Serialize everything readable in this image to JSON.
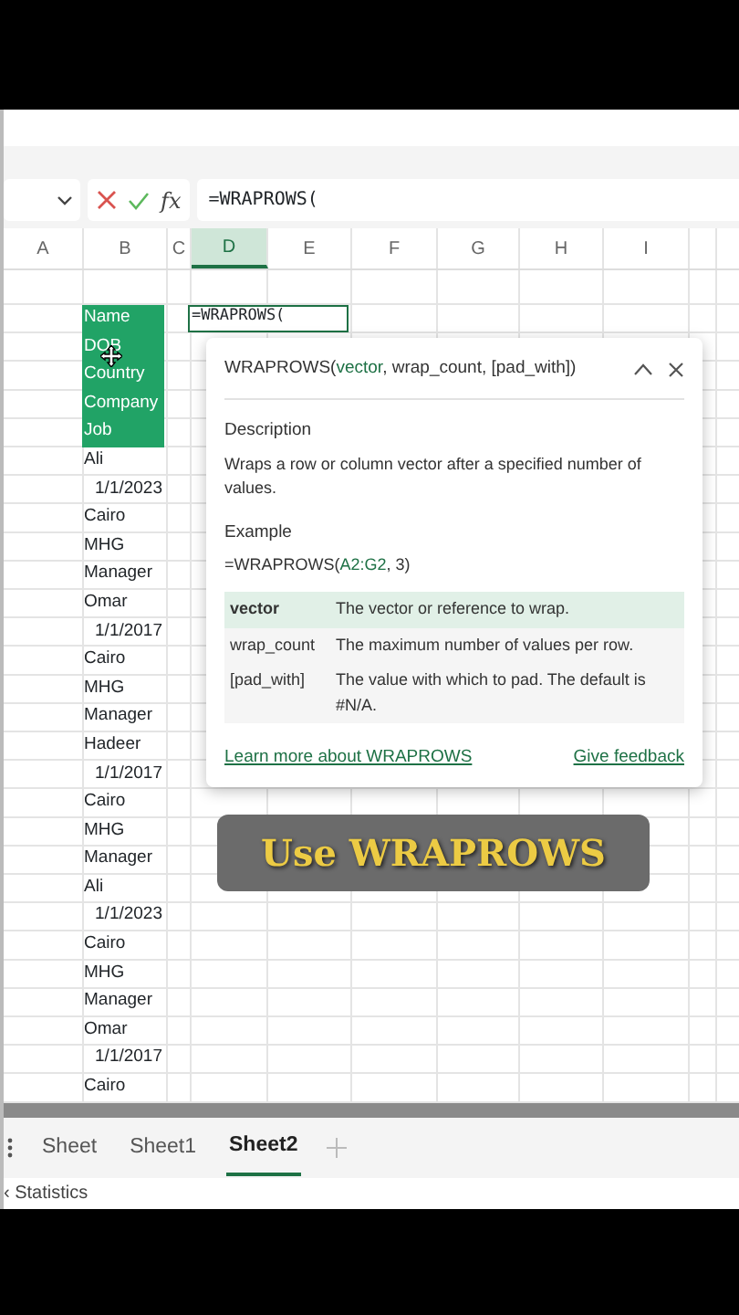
{
  "formula_bar": {
    "fx_label": "fx",
    "formula": "=WRAPROWS("
  },
  "columns": [
    {
      "label": "A",
      "selected": false
    },
    {
      "label": "B",
      "selected": false
    },
    {
      "label": "C",
      "selected": false
    },
    {
      "label": "D",
      "selected": true
    },
    {
      "label": "E",
      "selected": false
    },
    {
      "label": "F",
      "selected": false
    },
    {
      "label": "G",
      "selected": false
    },
    {
      "label": "H",
      "selected": false
    },
    {
      "label": "I",
      "selected": false
    }
  ],
  "column_b": [
    {
      "text": "Name",
      "kind": "header"
    },
    {
      "text": "DOB",
      "kind": "header"
    },
    {
      "text": "Country",
      "kind": "header"
    },
    {
      "text": "Company",
      "kind": "header"
    },
    {
      "text": "Job",
      "kind": "header"
    },
    {
      "text": "Ali",
      "kind": "text"
    },
    {
      "text": "1/1/2023",
      "kind": "date"
    },
    {
      "text": "Cairo",
      "kind": "text"
    },
    {
      "text": "MHG",
      "kind": "text"
    },
    {
      "text": "Manager",
      "kind": "text"
    },
    {
      "text": "Omar",
      "kind": "text"
    },
    {
      "text": "1/1/2017",
      "kind": "date"
    },
    {
      "text": "Cairo",
      "kind": "text"
    },
    {
      "text": "MHG",
      "kind": "text"
    },
    {
      "text": "Manager",
      "kind": "text"
    },
    {
      "text": "Hadeer",
      "kind": "text"
    },
    {
      "text": "1/1/2017",
      "kind": "date"
    },
    {
      "text": "Cairo",
      "kind": "text"
    },
    {
      "text": "MHG",
      "kind": "text"
    },
    {
      "text": "Manager",
      "kind": "text"
    },
    {
      "text": "Ali",
      "kind": "text"
    },
    {
      "text": "1/1/2023",
      "kind": "date"
    },
    {
      "text": "Cairo",
      "kind": "text"
    },
    {
      "text": "MHG",
      "kind": "text"
    },
    {
      "text": "Manager",
      "kind": "text"
    },
    {
      "text": "Omar",
      "kind": "text"
    },
    {
      "text": "1/1/2017",
      "kind": "date"
    },
    {
      "text": "Cairo",
      "kind": "text"
    }
  ],
  "active_cell": {
    "text": "=WRAPROWS("
  },
  "tooltip": {
    "signature": [
      {
        "text": "WRAPROWS(",
        "current": false
      },
      {
        "text": "vector",
        "current": true
      },
      {
        "text": ", wrap_count, [pad_with])",
        "current": false
      }
    ],
    "description_heading": "Description",
    "description": "Wraps a row or column vector after a specified number of values.",
    "example_heading": "Example",
    "example": [
      {
        "text": "=WRAPROWS(",
        "current": false
      },
      {
        "text": "A2:G2",
        "current": true
      },
      {
        "text": ", 3)",
        "current": false
      }
    ],
    "arguments": [
      {
        "name": "vector",
        "text": "The vector or reference to wrap.",
        "selected": true
      },
      {
        "name": "wrap_count",
        "text": "The maximum number of values per row.",
        "selected": false
      },
      {
        "name": "[pad_with]",
        "text": "The value with which to pad. The default is #N/A.",
        "selected": false
      }
    ],
    "links": [
      "Learn more about WRAPROWS",
      "Give feedback"
    ]
  },
  "caption": "Use WRAPROWS",
  "sheet_tabs": [
    {
      "label": "Sheet",
      "selected": false
    },
    {
      "label": "Sheet1",
      "selected": false
    },
    {
      "label": "Sheet2",
      "selected": true
    }
  ],
  "status_bar": "‹ Statistics"
}
